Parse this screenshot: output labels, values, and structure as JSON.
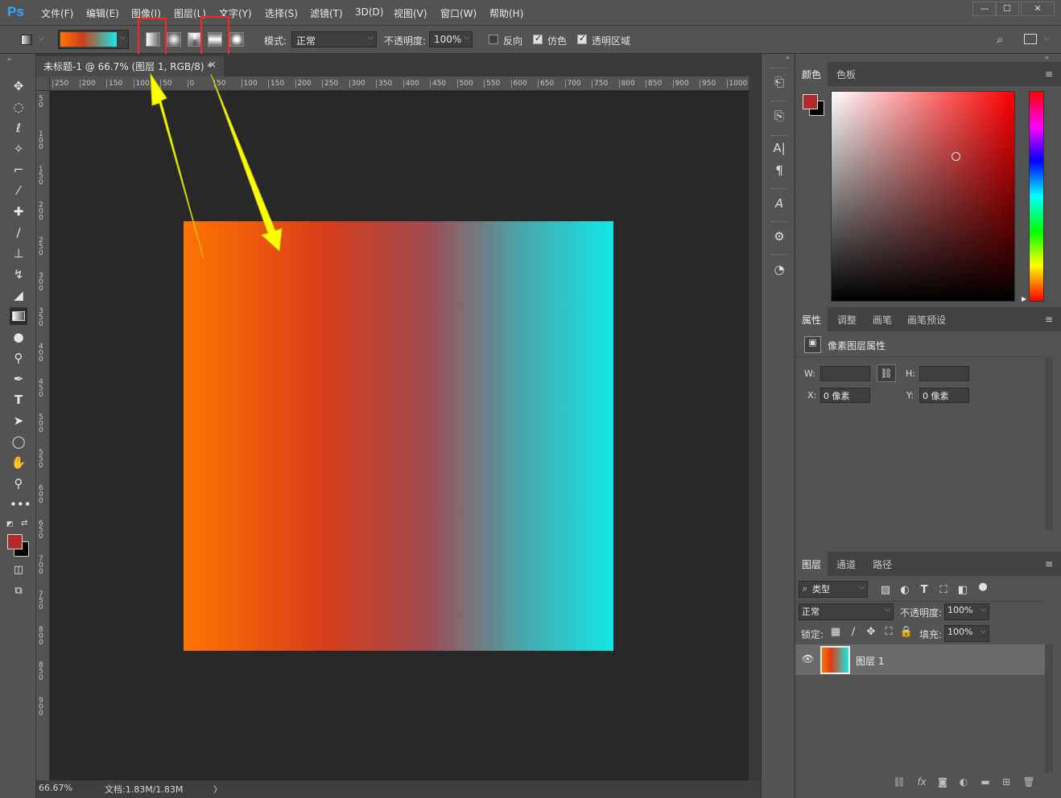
{
  "app": {
    "logo": "Ps"
  },
  "menu": [
    "文件(F)",
    "编辑(E)",
    "图像(I)",
    "图层(L)",
    "文字(Y)",
    "选择(S)",
    "滤镜(T)",
    "3D(D)",
    "视图(V)",
    "窗口(W)",
    "帮助(H)"
  ],
  "window_buttons": [
    "—",
    "☐",
    "✕"
  ],
  "options": {
    "mode_label": "模式:",
    "mode_value": "正常",
    "opacity_label": "不透明度:",
    "opacity_value": "100%",
    "reverse_label": "反向",
    "reverse_checked": false,
    "dither_label": "仿色",
    "dither_checked": true,
    "transparency_label": "透明区域",
    "transparency_checked": true
  },
  "document": {
    "tab_title": "未标题-1 @ 66.7% (图层 1, RGB/8) *",
    "close": "×",
    "zoom": "66.67%",
    "doc_info": "文档:1.83M/1.83M",
    "more": "〉"
  },
  "rulers": {
    "top": [
      "250",
      "200",
      "150",
      "100",
      "50",
      "0",
      "50",
      "100",
      "150",
      "200",
      "250",
      "300",
      "350",
      "400",
      "450",
      "500",
      "550",
      "600",
      "650",
      "700",
      "750",
      "800",
      "850",
      "900",
      "950",
      "1000"
    ],
    "left": [
      "5 0",
      "1 0 0",
      "1 5 0",
      "2 0 0",
      "2 5 0",
      "3 0 0",
      "3 5 0",
      "4 0 0",
      "4 5 0",
      "5 0 0",
      "5 5 0",
      "6 0 0",
      "6 5 0",
      "7 0 0",
      "7 5 0",
      "8 0 0",
      "8 5 0",
      "9 0 0"
    ]
  },
  "panels": {
    "color_tabs": [
      "颜色",
      "色板"
    ],
    "properties_tabs": [
      "属性",
      "调整",
      "画笔",
      "画笔预设"
    ],
    "properties_title": "像素图层属性",
    "w_label": "W:",
    "h_label": "H:",
    "x_label": "X:",
    "y_label": "Y:",
    "x_value": "0 像素",
    "y_value": "0 像素",
    "layers_tabs": [
      "图层",
      "通道",
      "路径"
    ],
    "filter_kind": "类型",
    "blend_mode": "正常",
    "opacity_label": "不透明度:",
    "opacity_value": "100%",
    "lock_label": "锁定:",
    "fill_label": "填充:",
    "fill_value": "100%",
    "layer_name": "图层 1"
  },
  "colors": {
    "foreground": "#b22a2a",
    "background": "#000000",
    "accent": "#31a8ff",
    "annotation_box": "#ff2222",
    "annotation_arrow": "#ffff00"
  }
}
